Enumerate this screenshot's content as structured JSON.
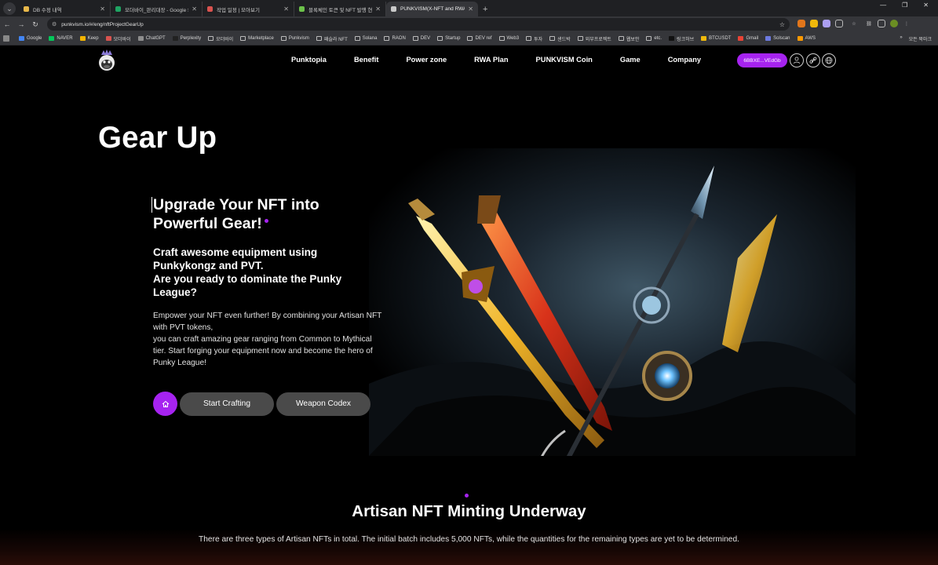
{
  "browser": {
    "tabs": [
      {
        "title": "DB 수정 내역",
        "favicon_color": "#e8b84a",
        "active": false
      },
      {
        "title": "모더바이_판리대장 - Google S",
        "favicon_color": "#1fa463",
        "active": false
      },
      {
        "title": "작업 일정 | 모아보기",
        "favicon_color": "#d9534f",
        "active": false
      },
      {
        "title": "블록체인 토큰 및 NFT 발행 현",
        "favicon_color": "#6cc24a",
        "active": false
      },
      {
        "title": "PUNKVISM(X-NFT and RWA)",
        "favicon_color": "#c9c9c9",
        "active": true
      }
    ],
    "url": "punkvism.io/#/eng/nftProjectGearUp",
    "bookmarks": [
      {
        "label": "Google",
        "icon_color": "#4285f4"
      },
      {
        "label": "NAVER",
        "icon_color": "#03c75a"
      },
      {
        "label": "Keep",
        "icon_color": "#f4b400"
      },
      {
        "label": "모더바이",
        "icon_color": "#d9534f"
      },
      {
        "label": "ChatGPT",
        "icon_color": "#8e8e8e"
      },
      {
        "label": "Perplexity",
        "icon_color": "#222222"
      },
      {
        "label": "모더바이",
        "folder": true
      },
      {
        "label": "Marketplace",
        "folder": true
      },
      {
        "label": "Punkvism",
        "folder": true
      },
      {
        "label": "패슬라 NFT",
        "folder": true
      },
      {
        "label": "Solana",
        "folder": true
      },
      {
        "label": "RAON",
        "folder": true
      },
      {
        "label": "DEV",
        "folder": true
      },
      {
        "label": "Startup",
        "folder": true
      },
      {
        "label": "DEV ref",
        "folder": true
      },
      {
        "label": "Web3",
        "folder": true
      },
      {
        "label": "투자",
        "folder": true
      },
      {
        "label": "샌드박",
        "folder": true
      },
      {
        "label": "외부프로젝트",
        "folder": true
      },
      {
        "label": "웹보안",
        "folder": true
      },
      {
        "label": "etc.",
        "folder": true
      },
      {
        "label": "링크허브",
        "icon_color": "#111111"
      },
      {
        "label": "BTCUSDT",
        "icon_color": "#f0b90b"
      },
      {
        "label": "Gmail",
        "icon_color": "#ea4335"
      },
      {
        "label": "Solscan",
        "icon_color": "#6c7ae0"
      },
      {
        "label": "AWS",
        "icon_color": "#ff9900"
      }
    ],
    "bookmarks_overflow": "»",
    "all_bookmarks": "모든 북마크"
  },
  "site": {
    "menu": [
      "Punktopia",
      "Benefit",
      "Power zone",
      "RWA Plan",
      "PUNKVISM Coin",
      "Game",
      "Company"
    ],
    "wallet_address": "6BBXE...VEdGb",
    "accent": "#a623f0",
    "icons": [
      "user-pay-icon",
      "link-icon",
      "globe-icon"
    ]
  },
  "hero": {
    "title": "Gear Up",
    "headline_lines": [
      "Upgrade Your NFT into",
      "Powerful Gear!"
    ],
    "subhead_lines": [
      "Craft awesome equipment using",
      "Punkykongz and PVT.",
      "Are you ready to dominate the Punky",
      "League?"
    ],
    "body_lines": [
      "Empower your NFT even further! By combining your Artisan NFT",
      "with PVT tokens,",
      "you can craft amazing gear ranging from Common to Mythical",
      "tier. Start forging your equipment now and become the hero of",
      "Punky League!"
    ],
    "buttons": {
      "start": "Start Crafting",
      "codex": "Weapon Codex"
    }
  },
  "minting": {
    "title": "Artisan NFT Minting Underway",
    "description": "There are three types of Artisan NFTs in total. The initial batch includes 5,000 NFTs, while the quantities for the remaining types are yet to be determined."
  }
}
